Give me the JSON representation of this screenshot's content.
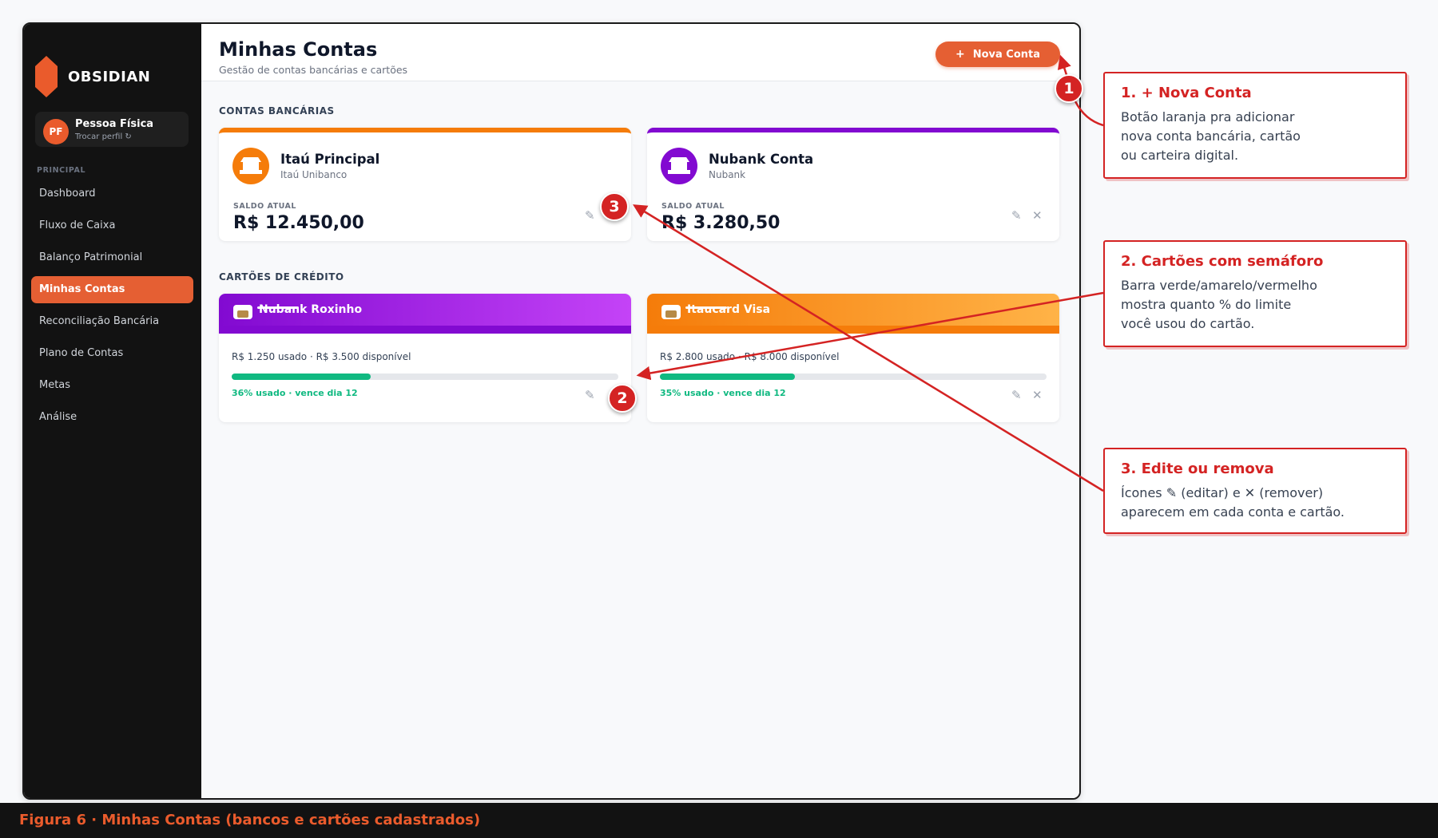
{
  "sidebar": {
    "brand": "OBSIDIAN",
    "profile": {
      "initials": "PF",
      "name": "Pessoa Física",
      "switch_label": "Trocar perfil ↻"
    },
    "section": "PRINCIPAL",
    "items": [
      {
        "label": "Dashboard"
      },
      {
        "label": "Fluxo de Caixa"
      },
      {
        "label": "Balanço Patrimonial"
      },
      {
        "label": "Minhas Contas",
        "active": true
      },
      {
        "label": "Reconciliação Bancária"
      },
      {
        "label": "Plano de Contas"
      },
      {
        "label": "Metas"
      },
      {
        "label": "Análise"
      }
    ]
  },
  "header": {
    "title": "Minhas Contas",
    "subtitle": "Gestão de contas bancárias e cartões",
    "new_button": {
      "icon": "+",
      "label": "Nova Conta"
    }
  },
  "bank_section": {
    "title": "CONTAS BANCÁRIAS",
    "balance_label": "SALDO ATUAL",
    "accounts": [
      {
        "name": "Itaú Principal",
        "institution": "Itaú Unibanco",
        "balance": "R$ 12.450,00",
        "color": "#f57c0a"
      },
      {
        "name": "Nubank Conta",
        "institution": "Nubank",
        "balance": "R$ 3.280,50",
        "color": "#820ad1"
      }
    ]
  },
  "card_section": {
    "title": "CARTÕES DE CRÉDITO",
    "cards": [
      {
        "name": "Nubank Roxinho",
        "usage": "R$ 1.250 usado  ·  R$ 3.500 disponível",
        "used_fraction": 0.36,
        "status": "36% usado  ·  vence dia 12",
        "gradient": [
          "#820ad1",
          "#c443f7"
        ],
        "strip": "#820ad1"
      },
      {
        "name": "Itaucard Visa",
        "usage": "R$ 2.800 usado  ·  R$ 8.000 disponível",
        "used_fraction": 0.35,
        "status": "35% usado  ·  vence dia 12",
        "gradient": [
          "#f57c0a",
          "#ffb347"
        ],
        "strip": "#f57c0a"
      }
    ]
  },
  "actions": {
    "edit_icon": "✎",
    "remove_icon": "✕"
  },
  "annotations": [
    {
      "number": "1",
      "title": "1. + Nova Conta",
      "text": "Botão laranja pra adicionar\nnova conta bancária, cartão\nou carteira digital."
    },
    {
      "number": "2",
      "title": "2. Cartões com semáforo",
      "text": "Barra verde/amarelo/vermelho\nmostra quanto % do limite\nvocê usou do cartão."
    },
    {
      "number": "3",
      "title": "3. Edite ou remova",
      "text": "Ícones ✎ (editar) e ✕ (remover)\naparecem em cada conta e cartão."
    }
  ],
  "footer": {
    "caption": "Figura 6  ·  Minhas Contas (bancos e cartões cadastrados)"
  },
  "colors": {
    "accent": "#e55f33",
    "annotation": "#d42323",
    "success": "#10b981",
    "sidebar_bg": "#121212"
  }
}
